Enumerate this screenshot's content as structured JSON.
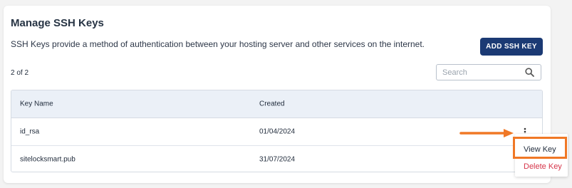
{
  "page": {
    "title": "Manage SSH Keys",
    "description": "SSH Keys provide a method of authentication between your hosting server and other services on the internet.",
    "add_button_label": "ADD SSH KEY",
    "count_text": "2 of 2"
  },
  "search": {
    "placeholder": "Search",
    "value": ""
  },
  "table": {
    "headers": [
      "Key Name",
      "Created"
    ],
    "rows": [
      {
        "name": "id_rsa",
        "created": "01/04/2024"
      },
      {
        "name": "sitelocksmart.pub",
        "created": "31/07/2024"
      }
    ]
  },
  "context_menu": {
    "view_label": "View Key",
    "delete_label": "Delete Key"
  },
  "colors": {
    "primary_button": "#1b3a74",
    "header_bg": "#ebf0f7",
    "highlight": "#f07826",
    "danger": "#d6354a"
  },
  "icons": {
    "search": "search-icon",
    "more": "kebab-menu-icon",
    "pointer": "arrow-right-icon"
  }
}
